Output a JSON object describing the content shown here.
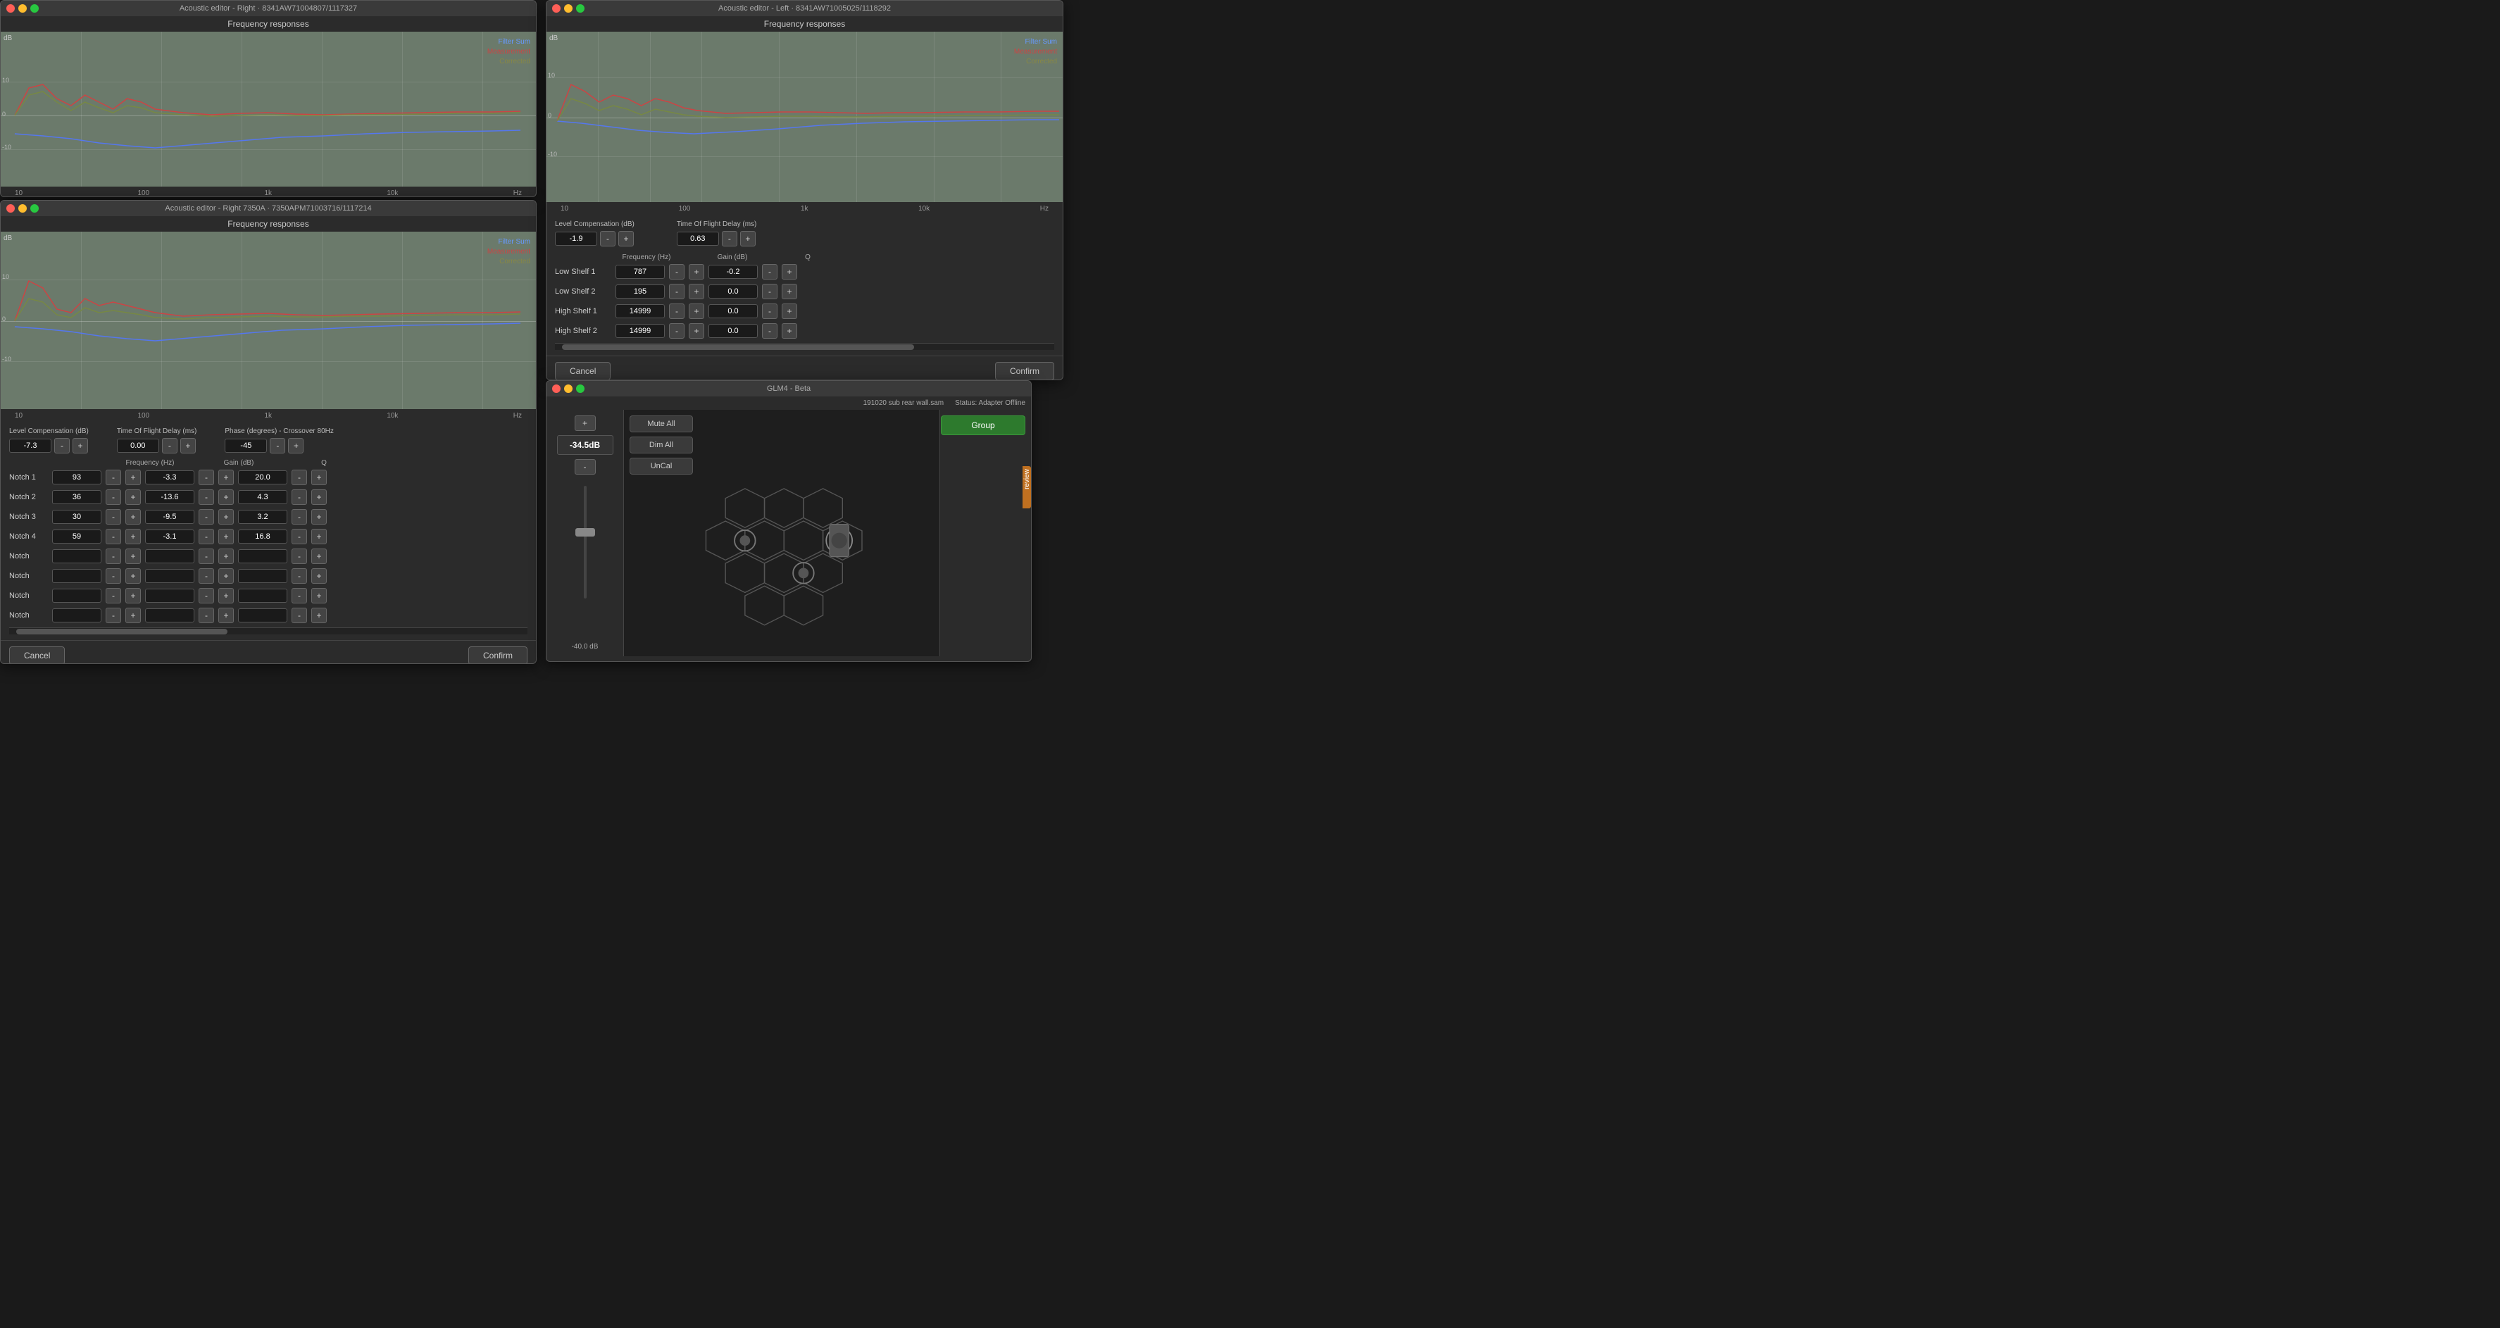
{
  "windows": {
    "acoustic_right_top": {
      "title": "Acoustic editor - Right · 8341AW71004807/1117327",
      "chart": {
        "title": "Frequency responses",
        "db_label": "dB",
        "legend": {
          "filter_sum": "Filter Sum",
          "measurement": "Measurement",
          "corrected": "Corrected"
        },
        "axis_labels": [
          "10",
          "100",
          "1k",
          "10k",
          "Hz"
        ]
      }
    },
    "acoustic_right_bottom": {
      "title": "Acoustic editor - Right 7350A · 7350APM71003716/1117214",
      "chart": {
        "title": "Frequency responses",
        "db_label": "dB",
        "legend": {
          "filter_sum": "Filter Sum",
          "measurement": "Measurement",
          "corrected": "Corrected"
        },
        "axis_labels": [
          "10",
          "100",
          "1k",
          "10k",
          "Hz"
        ]
      },
      "controls": {
        "level_compensation_label": "Level Compensation (dB)",
        "level_value": "-7.3",
        "tof_label": "Time Of Flight Delay (ms)",
        "tof_value": "0.00",
        "phase_label": "Phase (degrees) - Crossover 80Hz",
        "phase_value": "-45",
        "col_headers": {
          "frequency": "Frequency (Hz)",
          "gain": "Gain (dB)",
          "q": "Q"
        },
        "notches": [
          {
            "label": "Notch 1",
            "freq": "93",
            "gain": "-3.3",
            "q": "20.0"
          },
          {
            "label": "Notch 2",
            "freq": "36",
            "gain": "-13.6",
            "q": "4.3"
          },
          {
            "label": "Notch 3",
            "freq": "30",
            "gain": "-9.5",
            "q": "3.2"
          },
          {
            "label": "Notch 4",
            "freq": "59",
            "gain": "-3.1",
            "q": "16.8"
          },
          {
            "label": "Notch",
            "freq": "",
            "gain": "",
            "q": ""
          },
          {
            "label": "Notch",
            "freq": "",
            "gain": "",
            "q": ""
          },
          {
            "label": "Notch",
            "freq": "",
            "gain": "",
            "q": ""
          },
          {
            "label": "Notch",
            "freq": "",
            "gain": "",
            "q": ""
          }
        ],
        "cancel_label": "Cancel",
        "confirm_label": "Confirm"
      }
    },
    "acoustic_left": {
      "title": "Acoustic editor - Left · 8341AW71005025/1118292",
      "chart": {
        "title": "Frequency responses",
        "db_label": "dB",
        "legend": {
          "filter_sum": "Filter Sum",
          "measurement": "Measurement",
          "corrected": "Corrected"
        },
        "axis_labels": [
          "10",
          "100",
          "1k",
          "10k",
          "Hz"
        ]
      },
      "controls": {
        "level_compensation_label": "Level Compensation (dB)",
        "level_value": "-1.9",
        "tof_label": "Time Of Flight Delay (ms)",
        "tof_value": "0.63",
        "col_headers": {
          "frequency": "Frequency (Hz)",
          "gain": "Gain (dB)",
          "q": "Q"
        },
        "shelves": [
          {
            "label": "Low Shelf 1",
            "freq": "787",
            "gain": "-0.2"
          },
          {
            "label": "Low Shelf 2",
            "freq": "195",
            "gain": "0.0"
          },
          {
            "label": "High Shelf 1",
            "freq": "14999",
            "gain": "0.0"
          },
          {
            "label": "High Shelf 2",
            "freq": "14999",
            "gain": "0.0"
          }
        ],
        "cancel_label": "Cancel",
        "confirm_label": "Confirm"
      }
    },
    "glm4": {
      "title": "GLM4 - Beta",
      "top_bar": {
        "filename": "191020 sub rear wall.sam",
        "status": "Status: Adapter Offline"
      },
      "volume": "-34.5dB",
      "volume_plus": "+",
      "volume_minus": "-",
      "buttons": {
        "mute_all": "Mute All",
        "dim_all": "Dim All",
        "uncal": "UnCal",
        "group": "Group"
      },
      "fader_label": "-40.0 dB",
      "preview_label": "review"
    }
  }
}
